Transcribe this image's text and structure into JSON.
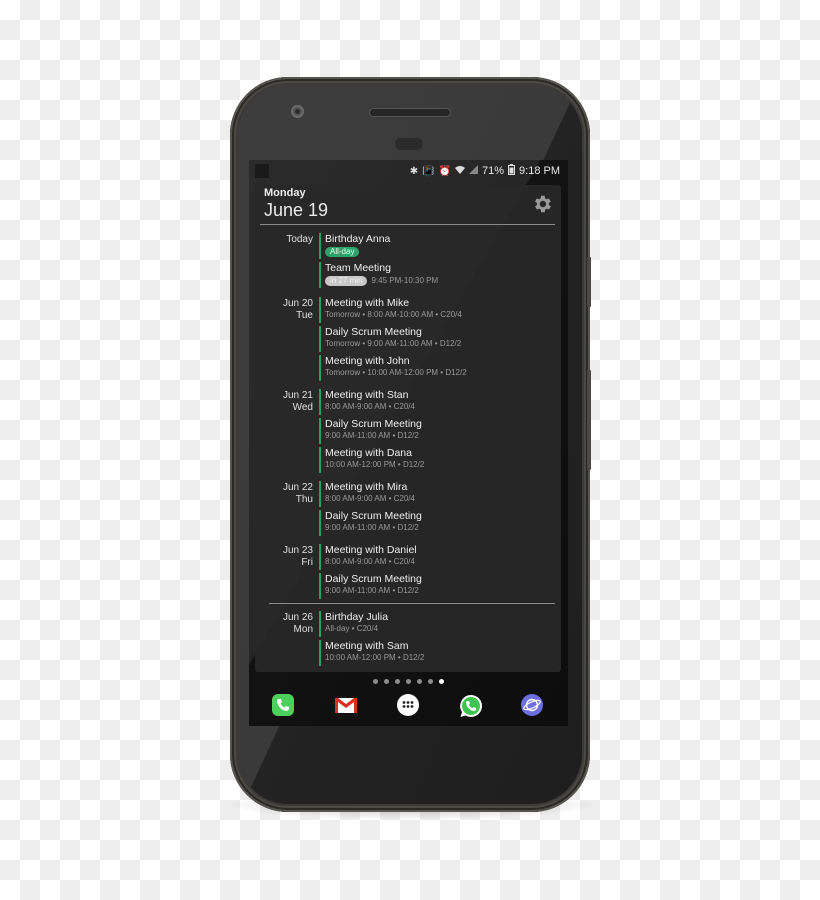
{
  "status_bar": {
    "icons": [
      "bluetooth-icon",
      "vibrate-icon",
      "alarm-icon",
      "wifi-icon",
      "signal-icon"
    ],
    "battery_percent": "71%",
    "time": "9:18 PM"
  },
  "widget": {
    "weekday": "Monday",
    "date": "June 19",
    "settings_icon": "gear-icon",
    "days": [
      {
        "label_line1": "Today",
        "label_line2": "",
        "events": [
          {
            "title": "Birthday Anna",
            "badge": "All-day",
            "badge_style": "green",
            "details": ""
          },
          {
            "title": "Team Meeting",
            "badge": "in 27 min",
            "badge_style": "grey",
            "details": "9:45 PM-10:30 PM"
          }
        ]
      },
      {
        "label_line1": "Jun 20",
        "label_line2": "Tue",
        "events": [
          {
            "title": "Meeting with Mike",
            "details": "Tomorrow  •  8:00 AM-10:00 AM  •  C20/4"
          },
          {
            "title": "Daily Scrum Meeting",
            "details": "Tomorrow  •  9:00 AM-11:00 AM  •  D12/2"
          },
          {
            "title": "Meeting with John",
            "details": "Tomorrow  •  10:00 AM-12:00 PM  •  D12/2"
          }
        ]
      },
      {
        "label_line1": "Jun 21",
        "label_line2": "Wed",
        "events": [
          {
            "title": "Meeting with Stan",
            "details": "8:00 AM-9:00 AM  •  C20/4"
          },
          {
            "title": "Daily Scrum Meeting",
            "details": "9:00 AM-11:00 AM  •  D12/2"
          },
          {
            "title": "Meeting with Dana",
            "details": "10:00 AM-12:00 PM  •  D12/2"
          }
        ]
      },
      {
        "label_line1": "Jun 22",
        "label_line2": "Thu",
        "events": [
          {
            "title": "Meeting with Mira",
            "details": "8:00 AM-9:00 AM  •  C20/4"
          },
          {
            "title": "Daily Scrum Meeting",
            "details": "9:00 AM-11:00 AM  •  D12/2"
          }
        ]
      },
      {
        "label_line1": "Jun 23",
        "label_line2": "Fri",
        "events": [
          {
            "title": "Meeting with Daniel",
            "details": "8:00 AM-9:00 AM  •  C20/4"
          },
          {
            "title": "Daily Scrum Meeting",
            "details": "9:00 AM-11:00 AM  •  D12/2"
          }
        ]
      },
      {
        "label_line1": "Jun 26",
        "label_line2": "Mon",
        "events": [
          {
            "title": "Birthday Julia",
            "details": "All-day  •  C20/4"
          },
          {
            "title": "Meeting with Sam",
            "details": "10:00 AM-12:00 PM  •  D12/2"
          }
        ]
      }
    ],
    "accent_color": "#2e9a66"
  },
  "home": {
    "page_count": 7,
    "active_page": 7,
    "dock": [
      {
        "name": "phone-app-icon",
        "color": "#4cd05c"
      },
      {
        "name": "gmail-app-icon",
        "color": "#d93025"
      },
      {
        "name": "app-drawer-icon",
        "color": "#ffffff"
      },
      {
        "name": "whatsapp-app-icon",
        "color": "#3ec44f"
      },
      {
        "name": "internet-browser-icon",
        "color": "#6b6fe0"
      }
    ]
  }
}
